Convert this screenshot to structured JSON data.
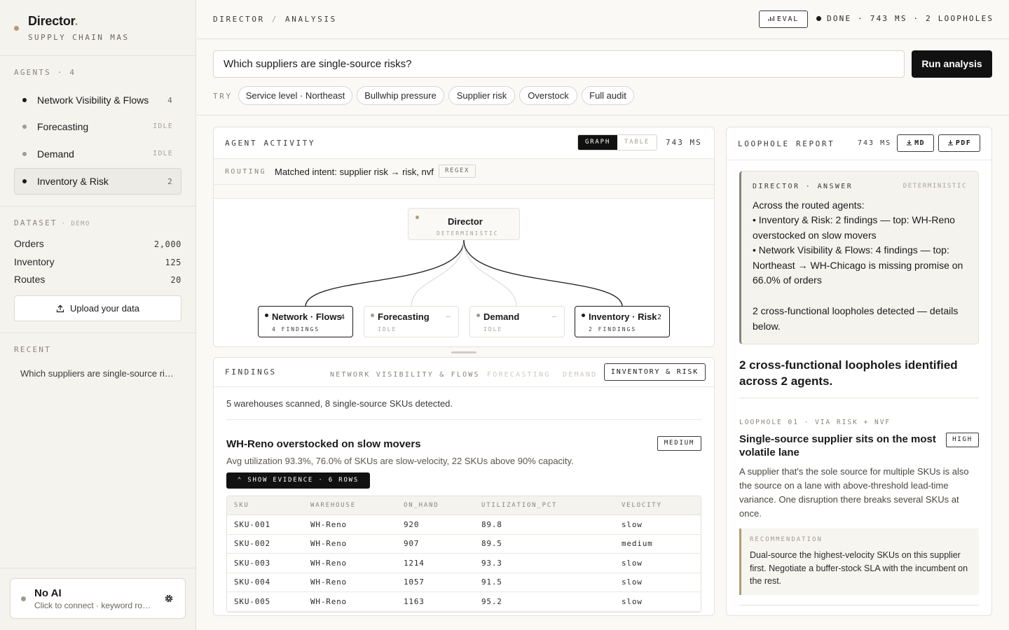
{
  "brand": {
    "title": "Director",
    "title_accent": ".",
    "subtitle": "SUPPLY CHAIN MAS"
  },
  "agents": {
    "label": "AGENTS · 4",
    "items": [
      {
        "name": "Network Visibility & Flows",
        "count": "4",
        "status": "active"
      },
      {
        "name": "Forecasting",
        "count": "IDLE",
        "status": "idle"
      },
      {
        "name": "Demand",
        "count": "IDLE",
        "status": "idle"
      },
      {
        "name": "Inventory & Risk",
        "count": "2",
        "status": "active"
      }
    ]
  },
  "dataset": {
    "label": "DATASET",
    "tag": "· DEMO",
    "rows": [
      {
        "name": "Orders",
        "value": "2,000"
      },
      {
        "name": "Inventory",
        "value": "125"
      },
      {
        "name": "Routes",
        "value": "20"
      }
    ],
    "upload_label": "Upload your data"
  },
  "recent": {
    "label": "RECENT",
    "items": [
      "Which suppliers are single-source risks?"
    ]
  },
  "ai": {
    "title": "No AI",
    "subtitle": "Click to connect · keyword routing"
  },
  "topbar": {
    "crumb_root": "DIRECTOR",
    "crumb_sep": "/",
    "crumb_page": "ANALYSIS",
    "eval_label": "EVAL",
    "status": "DONE · 743 MS · 2 LOOPHOLES"
  },
  "query": {
    "value": "Which suppliers are single-source risks?",
    "run_label": "Run analysis",
    "try_label": "TRY",
    "suggestions": [
      "Service level · Northeast",
      "Bullwhip pressure",
      "Supplier risk",
      "Overstock",
      "Full audit"
    ]
  },
  "activity": {
    "title": "AGENT ACTIVITY",
    "view_graph": "GRAPH",
    "view_table": "TABLE",
    "ms": "743 MS",
    "routing_label": "ROUTING",
    "routing_text": "Matched intent: supplier risk → risk, nvf",
    "routing_badge": "REGEX",
    "graph": {
      "root": {
        "name": "Director",
        "sub": "DETERMINISTIC"
      },
      "children": [
        {
          "name": "Network · Flows",
          "count": "4",
          "sub": "4 FINDINGS",
          "active": true
        },
        {
          "name": "Forecasting",
          "count": "–",
          "sub": "IDLE",
          "active": false
        },
        {
          "name": "Demand",
          "count": "–",
          "sub": "IDLE",
          "active": false
        },
        {
          "name": "Inventory · Risk",
          "count": "2",
          "sub": "2 FINDINGS",
          "active": true
        }
      ]
    }
  },
  "findings": {
    "title": "FINDINGS",
    "tabs": [
      "NETWORK VISIBILITY & FLOWS",
      "FORECASTING",
      "DEMAND"
    ],
    "active_tab": "INVENTORY & RISK",
    "summary": "5 warehouses scanned, 8 single-source SKUs detected.",
    "item": {
      "title": "WH-Reno overstocked on slow movers",
      "severity": "MEDIUM",
      "desc": "Avg utilization 93.3%, 76.0% of SKUs are slow-velocity, 22 SKUs above 90% capacity.",
      "evidence_label": "⌃ SHOW EVIDENCE · 6 ROWS",
      "columns": [
        "SKU",
        "WAREHOUSE",
        "ON_HAND",
        "UTILIZATION_PCT",
        "VELOCITY"
      ],
      "rows": [
        [
          "SKU-001",
          "WH-Reno",
          "920",
          "89.8",
          "slow"
        ],
        [
          "SKU-002",
          "WH-Reno",
          "907",
          "89.5",
          "medium"
        ],
        [
          "SKU-003",
          "WH-Reno",
          "1214",
          "93.3",
          "slow"
        ],
        [
          "SKU-004",
          "WH-Reno",
          "1057",
          "91.5",
          "slow"
        ],
        [
          "SKU-005",
          "WH-Reno",
          "1163",
          "95.2",
          "slow"
        ]
      ]
    }
  },
  "report": {
    "title": "LOOPHOLE REPORT",
    "ms": "743 MS",
    "md_label": "MD",
    "pdf_label": "PDF",
    "answer": {
      "label": "DIRECTOR · ANSWER",
      "tag": "DETERMINISTIC",
      "lines": [
        "Across the routed agents:",
        "• Inventory & Risk: 2 findings — top: WH-Reno overstocked on slow movers",
        "• Network Visibility & Flows: 4 findings — top: Northeast → WH-Chicago is missing promise on 66.0% of orders",
        "2 cross-functional loopholes detected — details below."
      ]
    },
    "heading": "2 cross-functional loopholes identified across 2 agents.",
    "loophole": {
      "label": "LOOPHOLE 01 · VIA RISK + NVF",
      "title": "Single-source supplier sits on the most volatile lane",
      "severity": "HIGH",
      "desc": "A supplier that's the sole source for multiple SKUs is also the source on a lane with above-threshold lead-time variance. One disruption there breaks several SKUs at once.",
      "rec_label": "RECOMMENDATION",
      "rec_text": "Dual-source the highest-velocity SKUs on this supplier first. Negotiate a buffer-stock SLA with the incumbent on the rest."
    }
  }
}
